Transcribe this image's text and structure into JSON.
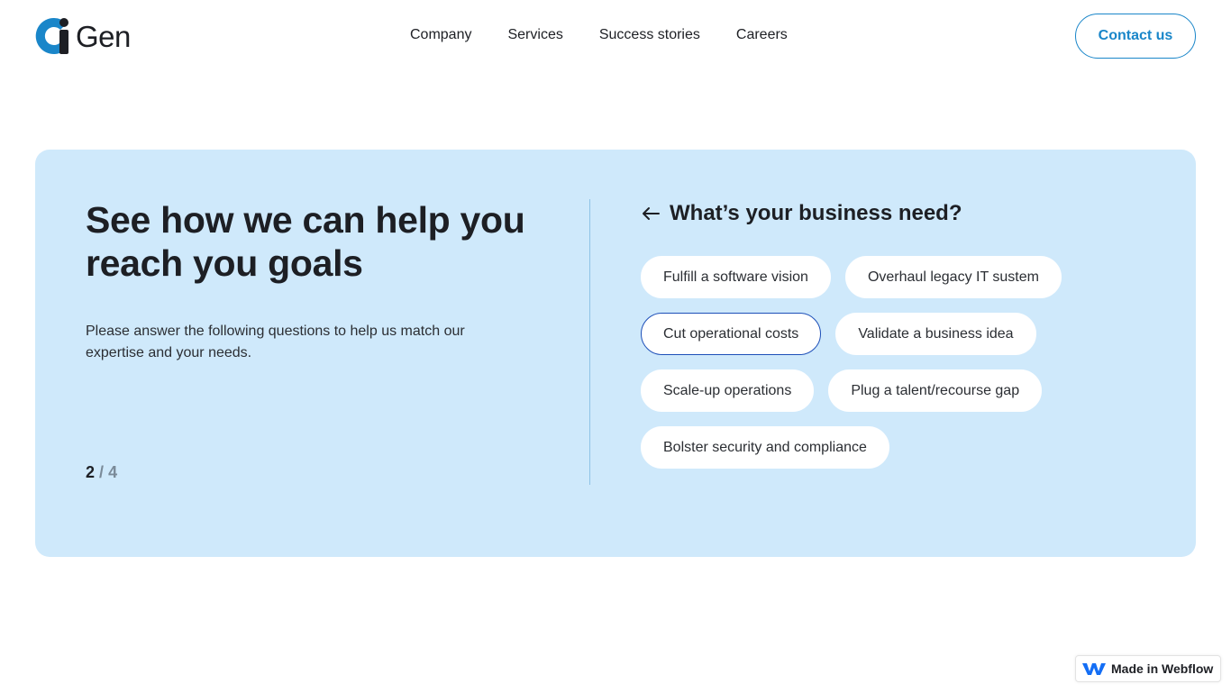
{
  "brand": {
    "name": "Gen",
    "accent": "#1a86c9"
  },
  "nav": {
    "items": [
      {
        "label": "Company"
      },
      {
        "label": "Services"
      },
      {
        "label": "Success stories"
      },
      {
        "label": "Careers"
      }
    ],
    "contact_label": "Contact us"
  },
  "intro": {
    "heading": "See how we can help you reach you goals",
    "description": "Please answer the following questions to help us match our expertise and your needs.",
    "step_current": "2",
    "step_separator": "/",
    "step_total": "4"
  },
  "question": {
    "title": "What’s your business need?",
    "options": [
      {
        "label": "Fulfill a software vision",
        "selected": false
      },
      {
        "label": "Overhaul legacy IT sustem",
        "selected": false
      },
      {
        "label": "Cut operational costs",
        "selected": true
      },
      {
        "label": "Validate a business idea",
        "selected": false
      },
      {
        "label": "Scale-up operations",
        "selected": false
      },
      {
        "label": "Plug a talent/recourse gap",
        "selected": false
      },
      {
        "label": "Bolster security and compliance",
        "selected": false
      }
    ]
  },
  "badge": {
    "label": "Made in Webflow"
  },
  "colors": {
    "card_bg": "#cfe9fb",
    "selected_border": "#1d4fb8"
  }
}
